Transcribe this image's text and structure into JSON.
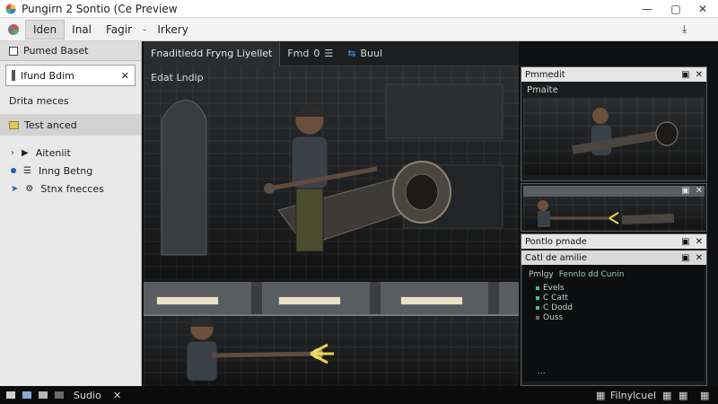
{
  "window": {
    "title": "Pungirn 2 Sontio (Ce Preview",
    "controls": {
      "minimize": "—",
      "maximize": "▢",
      "close": "✕"
    }
  },
  "menubar": {
    "items": [
      "Iden",
      "Inal",
      "Fagir",
      "Irkery"
    ],
    "separator": "-",
    "right_icon": "⤓"
  },
  "left_panel": {
    "header": "Pumed Baset",
    "tab_label": "Ifund Bdim",
    "tab_close": "✕",
    "items": [
      {
        "label": "Drita meces",
        "icon": "",
        "highlight": false
      },
      {
        "label": "Test anced",
        "icon": "",
        "highlight": true
      }
    ],
    "subitems": [
      {
        "label": "Aiteniit"
      },
      {
        "label": "Inng Betng"
      },
      {
        "label": "Stnx fnecces"
      }
    ]
  },
  "center": {
    "tabs": {
      "active": "Fnaditiedd Fryng Liyellet",
      "plain": "Fmd",
      "plain_value": "0",
      "plain_icon": "☰",
      "arrows": "⇆",
      "mode": "Buul"
    },
    "scene_top_label": "Edat Lndip"
  },
  "right_panels": {
    "top": {
      "title": "Pmmedit",
      "subtitle": "Pmaite",
      "controls": [
        "▣",
        "✕"
      ]
    },
    "middle": {
      "controls": [
        "▣",
        "✕"
      ]
    },
    "bottom": {
      "title": "Pontlo pmade",
      "controls": [
        "▣",
        "✕"
      ],
      "sub_label": "Catl de amilie",
      "sub_controls": [
        "▣",
        "✕"
      ],
      "tree_title": "Pmlgy",
      "tree_value": "Fennlo dd Cunin",
      "tree_rows": [
        "Evels",
        "C Catt",
        "C Dodd",
        "Ouss"
      ],
      "footer": "..."
    }
  },
  "statusbar": {
    "label": "Sudio",
    "close": "✕",
    "right_label": "Filnylcuel"
  },
  "colors": {
    "accent_green": "#3fc28a",
    "highlight_yellow": "#e7d24a",
    "panel_bg": "#1a1c1d",
    "ui_light": "#ffffff"
  }
}
